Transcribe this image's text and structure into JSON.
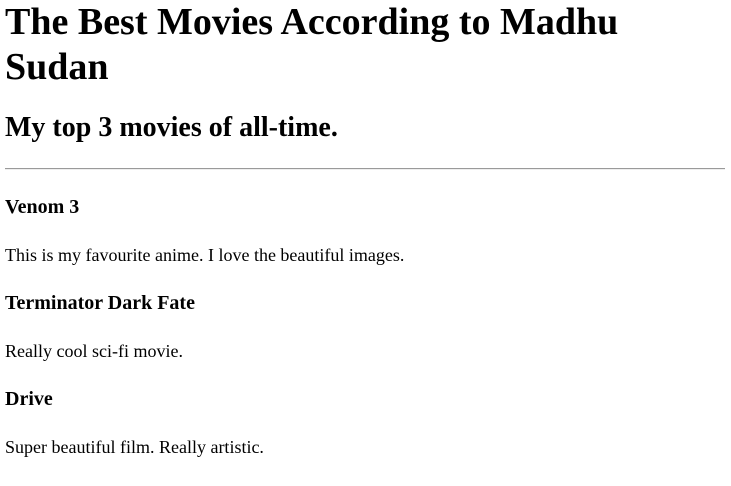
{
  "page": {
    "title": "The Best Movies According to Madhu Sudan",
    "subtitle": "My top 3 movies of all-time."
  },
  "movies": [
    {
      "title": "Venom 3",
      "description": "This is my favourite anime. I love the beautiful images."
    },
    {
      "title": "Terminator Dark Fate",
      "description": "Really cool sci-fi movie."
    },
    {
      "title": "Drive",
      "description": "Super beautiful film. Really artistic."
    }
  ]
}
